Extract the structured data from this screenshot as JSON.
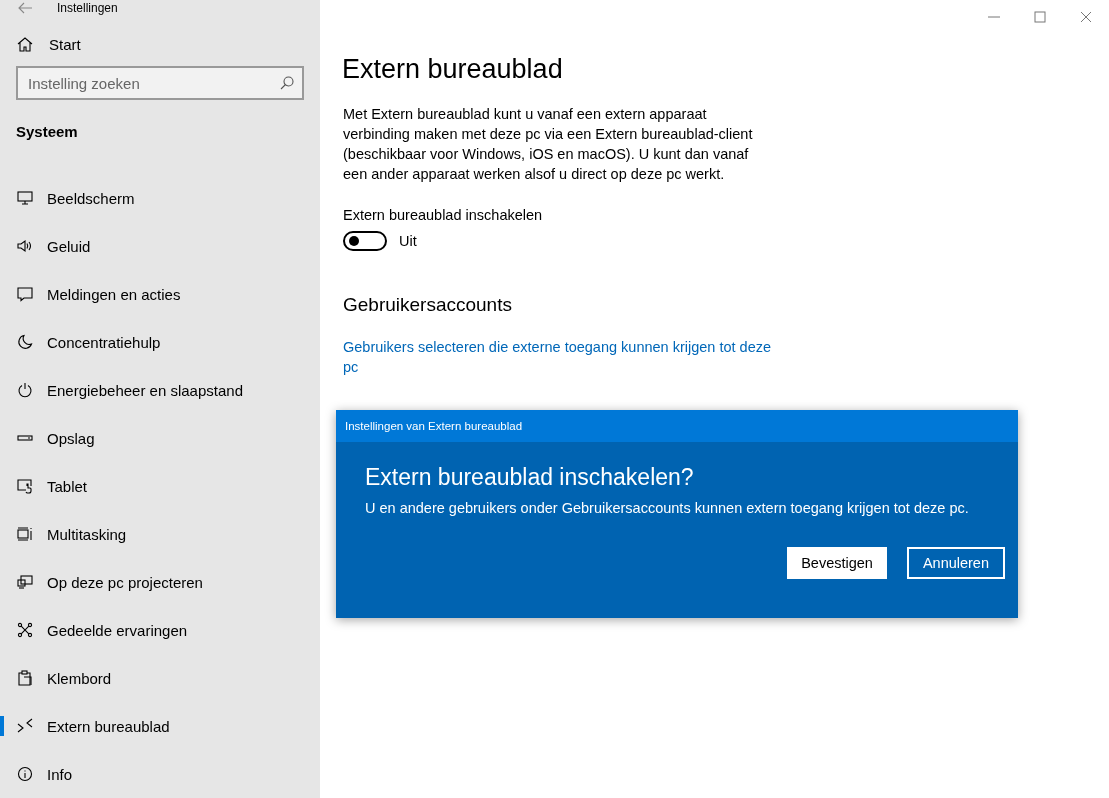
{
  "window": {
    "title": "Instellingen"
  },
  "sidebar": {
    "home": "Start",
    "search": {
      "placeholder": "Instelling zoeken"
    },
    "section": "Systeem",
    "items": [
      {
        "label": "Beeldscherm",
        "selected": false
      },
      {
        "label": "Geluid",
        "selected": false
      },
      {
        "label": "Meldingen en acties",
        "selected": false
      },
      {
        "label": "Concentratiehulp",
        "selected": false
      },
      {
        "label": "Energiebeheer en slaapstand",
        "selected": false
      },
      {
        "label": "Opslag",
        "selected": false
      },
      {
        "label": "Tablet",
        "selected": false
      },
      {
        "label": "Multitasking",
        "selected": false
      },
      {
        "label": "Op deze pc projecteren",
        "selected": false
      },
      {
        "label": "Gedeelde ervaringen",
        "selected": false
      },
      {
        "label": "Klembord",
        "selected": false
      },
      {
        "label": "Extern bureaublad",
        "selected": true
      },
      {
        "label": "Info",
        "selected": false
      }
    ]
  },
  "content": {
    "title": "Extern bureaublad",
    "description": "Met Extern bureaublad kunt u vanaf een extern apparaat verbinding maken met deze pc via een Extern bureaublad-client (beschikbaar voor Windows, iOS en macOS). U kunt dan vanaf een ander apparaat werken alsof u direct op deze pc werkt.",
    "toggle": {
      "label": "Extern bureaublad inschakelen",
      "on": false,
      "state_text": "Uit"
    },
    "section": "Gebruikersaccounts",
    "link": "Gebruikers selecteren die externe toegang kunnen krijgen tot deze pc"
  },
  "dialog": {
    "title": "Instellingen van Extern bureaublad",
    "heading": "Extern bureaublad inschakelen?",
    "message": "U en andere gebruikers onder Gebruikersaccounts kunnen extern toegang krijgen tot deze pc.",
    "buttons": [
      {
        "label": "Bevestigen",
        "kind": "primary"
      },
      {
        "label": "Annuleren",
        "kind": "secondary"
      }
    ]
  }
}
